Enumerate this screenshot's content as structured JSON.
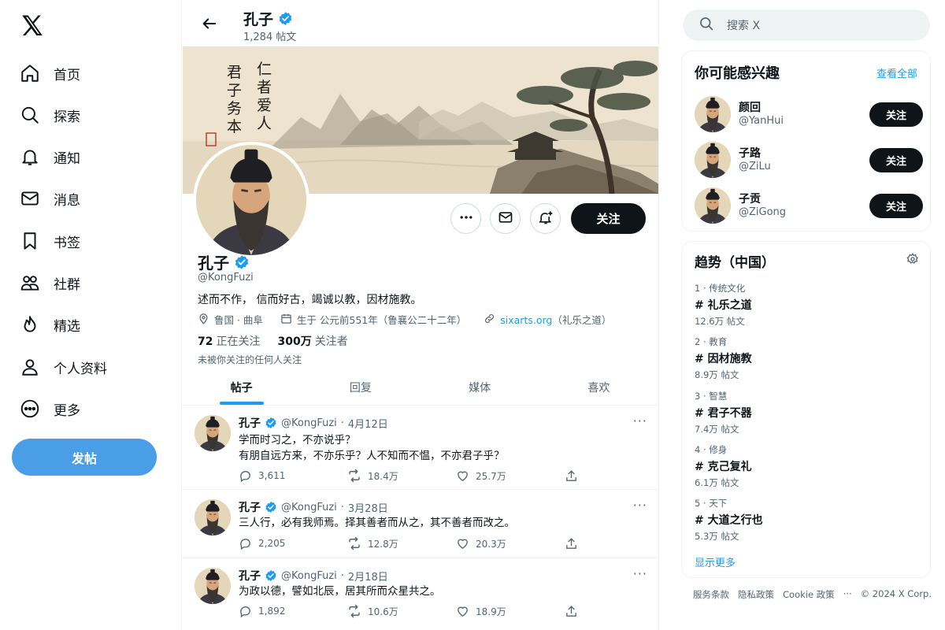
{
  "nav": {
    "items": [
      {
        "label": "首页",
        "icon": "home-icon"
      },
      {
        "label": "探索",
        "icon": "search-icon"
      },
      {
        "label": "通知",
        "icon": "bell-icon"
      },
      {
        "label": "消息",
        "icon": "mail-icon"
      },
      {
        "label": "书签",
        "icon": "bookmark-icon"
      },
      {
        "label": "社群",
        "icon": "people-icon"
      },
      {
        "label": "精选",
        "icon": "flame-icon"
      },
      {
        "label": "个人资料",
        "icon": "person-icon"
      },
      {
        "label": "更多",
        "icon": "more-circle-icon"
      }
    ],
    "post_button": "发帖"
  },
  "header": {
    "name": "孔子",
    "post_count": "1,284 帖文"
  },
  "banner": {
    "calligraphy_right": "仁者爱人",
    "calligraphy_left": "君子务本"
  },
  "profile": {
    "name": "孔子",
    "handle": "@KongFuzi",
    "bio": "述而不作， 信而好古，竭诚以教，因材施教。",
    "location": "鲁国 · 曲阜",
    "born": "生于 公元前551年（鲁襄公二十二年）",
    "website": "sixarts.org",
    "website_note": "（礼乐之道）",
    "following_count": "72",
    "following_label": "正在关注",
    "followers_count": "300万",
    "followers_label": "关注者",
    "followed_by": "未被你关注的任何人关注",
    "follow_button": "关注"
  },
  "tabs": [
    "帖子",
    "回复",
    "媒体",
    "喜欢"
  ],
  "posts": [
    {
      "name": "孔子",
      "handle": "@KongFuzi",
      "sep": "·",
      "date": "4月12日",
      "lines": [
        "学而时习之，不亦说乎？",
        "有朋自远方来，不亦乐乎？人不知而不愠，不亦君子乎？"
      ],
      "replies": "3,611",
      "reposts": "18.4万",
      "likes": "25.7万"
    },
    {
      "name": "孔子",
      "handle": "@KongFuzi",
      "sep": "·",
      "date": "3月28日",
      "lines": [
        "三人行，必有我师焉。择其善者而从之，其不善者而改之。"
      ],
      "replies": "2,205",
      "reposts": "12.8万",
      "likes": "20.3万"
    },
    {
      "name": "孔子",
      "handle": "@KongFuzi",
      "sep": "·",
      "date": "2月18日",
      "lines": [
        "为政以德，譬如北辰，居其所而众星共之。"
      ],
      "replies": "1,892",
      "reposts": "10.6万",
      "likes": "18.9万"
    }
  ],
  "search": {
    "placeholder": "搜索 X"
  },
  "who_to_follow": {
    "title": "你可能感兴趣",
    "see_all": "查看全部",
    "users": [
      {
        "name": "颜回",
        "handle": "@YanHui",
        "button": "关注"
      },
      {
        "name": "子路",
        "handle": "@ZiLu",
        "button": "关注"
      },
      {
        "name": "子贡",
        "handle": "@ZiGong",
        "button": "关注"
      }
    ]
  },
  "trends": {
    "title": "趋势（中国）",
    "items": [
      {
        "category": "1 · 传统文化",
        "tag": "# 礼乐之道",
        "count": "12.6万 帖文"
      },
      {
        "category": "2 · 教育",
        "tag": "# 因材施教",
        "count": "8.9万 帖文"
      },
      {
        "category": "3 · 智慧",
        "tag": "# 君子不器",
        "count": "7.4万 帖文"
      },
      {
        "category": "4 · 修身",
        "tag": "# 克己复礼",
        "count": "6.1万 帖文"
      },
      {
        "category": "5 · 天下",
        "tag": "# 大道之行也",
        "count": "5.3万 帖文"
      }
    ],
    "show_more": "显示更多"
  },
  "footer": {
    "terms": "服务条款",
    "privacy": "隐私政策",
    "cookie": "Cookie 政策",
    "more": "···",
    "copyright": "© 2024 X Corp."
  },
  "colors": {
    "accent": "#1d9bf0",
    "post_button": "#4a9ee8",
    "dark_button": "#0f1419",
    "muted": "#536471",
    "verified": "#1d9bf0"
  }
}
